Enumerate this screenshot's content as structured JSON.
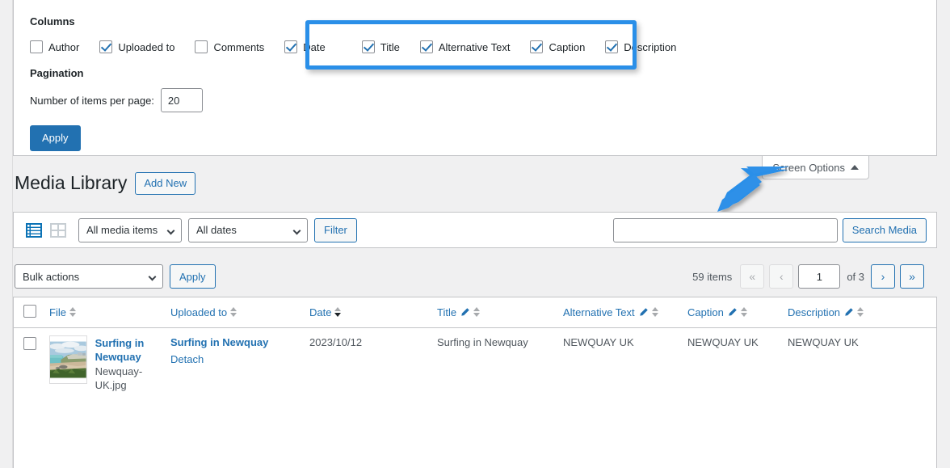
{
  "screen_options": {
    "columns_heading": "Columns",
    "columns": [
      {
        "label": "Author",
        "checked": false
      },
      {
        "label": "Uploaded to",
        "checked": true
      },
      {
        "label": "Comments",
        "checked": false
      },
      {
        "label": "Date",
        "checked": true
      },
      {
        "label": "Title",
        "checked": true
      },
      {
        "label": "Alternative Text",
        "checked": true
      },
      {
        "label": "Caption",
        "checked": true
      },
      {
        "label": "Description",
        "checked": true
      }
    ],
    "pagination_heading": "Pagination",
    "items_per_page_label": "Number of items per page:",
    "items_per_page_value": "20",
    "apply_label": "Apply",
    "tab_label": "Screen Options",
    "tab_caret_icon": "caret-up-icon",
    "highlight_color": "#2a8fe8"
  },
  "annotations": {
    "arrow_color": "#2a8fe8",
    "arrow_icon": "arrow-pointer-icon",
    "highlight_box_icon": "highlight-rectangle"
  },
  "header": {
    "title": "Media Library",
    "add_new_label": "Add New"
  },
  "toolbar": {
    "list_view_icon": "list-view-icon",
    "grid_view_icon": "grid-view-icon",
    "media_filter_value": "All media items",
    "dates_filter_value": "All dates",
    "filter_label": "Filter",
    "search_value": "",
    "search_placeholder": "",
    "search_button_label": "Search Media"
  },
  "bulk": {
    "actions_value": "Bulk actions",
    "apply_label": "Apply"
  },
  "pager": {
    "items_count": "59 items",
    "first_label": "«",
    "prev_label": "‹",
    "current_page": "1",
    "of_label": "of 3",
    "next_label": "›",
    "last_label": "»"
  },
  "table": {
    "columns": [
      {
        "label": "File",
        "sortable": true,
        "editable": false,
        "sort_active": false
      },
      {
        "label": "Uploaded to",
        "sortable": true,
        "editable": false,
        "sort_active": false
      },
      {
        "label": "Date",
        "sortable": true,
        "editable": false,
        "sort_active": true
      },
      {
        "label": "Title",
        "sortable": true,
        "editable": true,
        "sort_active": false
      },
      {
        "label": "Alternative Text",
        "sortable": true,
        "editable": true,
        "sort_active": false
      },
      {
        "label": "Caption",
        "sortable": true,
        "editable": true,
        "sort_active": false
      },
      {
        "label": "Description",
        "sortable": true,
        "editable": true,
        "sort_active": false
      }
    ],
    "rows": [
      {
        "thumbnail_icon": "beach-photo-thumbnail",
        "file_title": "Surfing in Newquay",
        "file_name": "Newquay-UK.jpg",
        "uploaded_to": "Surfing in Newquay",
        "detach_label": "Detach",
        "date": "2023/10/12",
        "title": "Surfing in Newquay",
        "alt_text": "NEWQUAY UK",
        "caption": "NEWQUAY UK",
        "description": "NEWQUAY UK"
      }
    ]
  }
}
